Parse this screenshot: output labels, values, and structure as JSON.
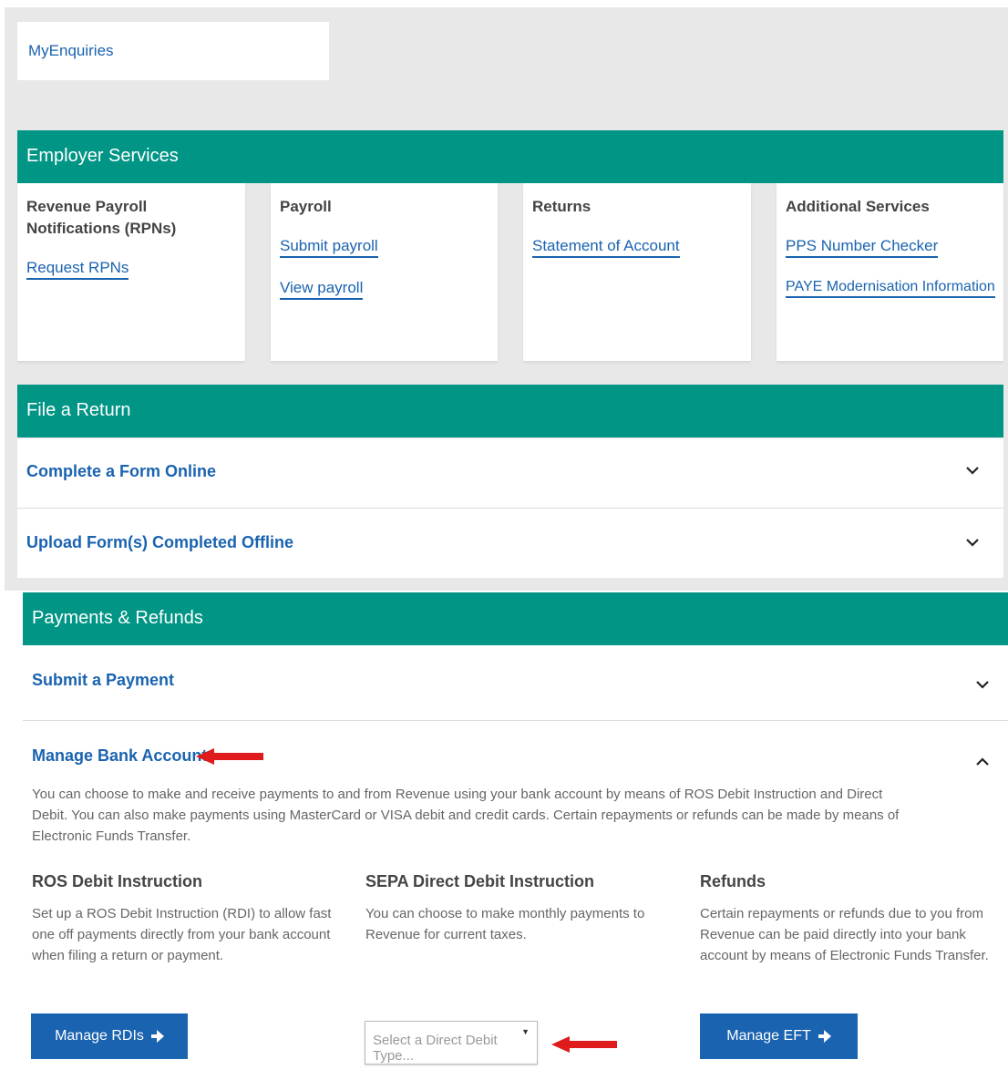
{
  "my_enquiries": {
    "label": "MyEnquiries"
  },
  "employer_services": {
    "title": "Employer Services",
    "cards": [
      {
        "heading": "Revenue Payroll Notifications (RPNs)",
        "links": [
          "Request RPNs"
        ]
      },
      {
        "heading": "Payroll",
        "links": [
          "Submit payroll",
          "View payroll"
        ]
      },
      {
        "heading": "Returns",
        "links": [
          "Statement of Account"
        ]
      },
      {
        "heading": "Additional Services",
        "links": [
          "PPS Number Checker",
          "PAYE Modernisation Information"
        ]
      }
    ]
  },
  "file_return": {
    "title": "File a Return",
    "items": [
      {
        "label": "Complete a Form Online"
      },
      {
        "label": "Upload Form(s) Completed Offline"
      }
    ]
  },
  "payments": {
    "title": "Payments & Refunds",
    "submit_payment": "Submit a Payment",
    "manage_bank": {
      "label": "Manage Bank Accounts",
      "description": "You can choose to make and receive payments to and from Revenue using your bank account by means of ROS Debit Instruction and Direct Debit. You can also make payments using MasterCard or VISA debit and credit cards. Certain repayments or refunds can be made by means of Electronic Funds Transfer.",
      "columns": [
        {
          "title": "ROS Debit Instruction",
          "text": "Set up a ROS Debit Instruction (RDI) to allow fast one off payments directly from your bank account when filing a return or payment."
        },
        {
          "title": "SEPA Direct Debit Instruction",
          "text": "You can choose to make monthly payments to Revenue for current taxes."
        },
        {
          "title": "Refunds",
          "text": "Certain repayments or refunds due to you from Revenue can be paid directly into your bank account by means of Electronic Funds Transfer."
        }
      ],
      "manage_rdis_label": "Manage RDIs",
      "select_placeholder": "Select a Direct Debit Type...",
      "manage_eft_label": "Manage EFT"
    }
  },
  "colors": {
    "teal": "#009585",
    "link_blue": "#1a63b0",
    "arrow_red": "#e01b1b"
  },
  "icons": {
    "collapsed": "chevron-down-icon",
    "expanded": "chevron-up-icon",
    "button_arrow": "arrow-right-icon"
  }
}
